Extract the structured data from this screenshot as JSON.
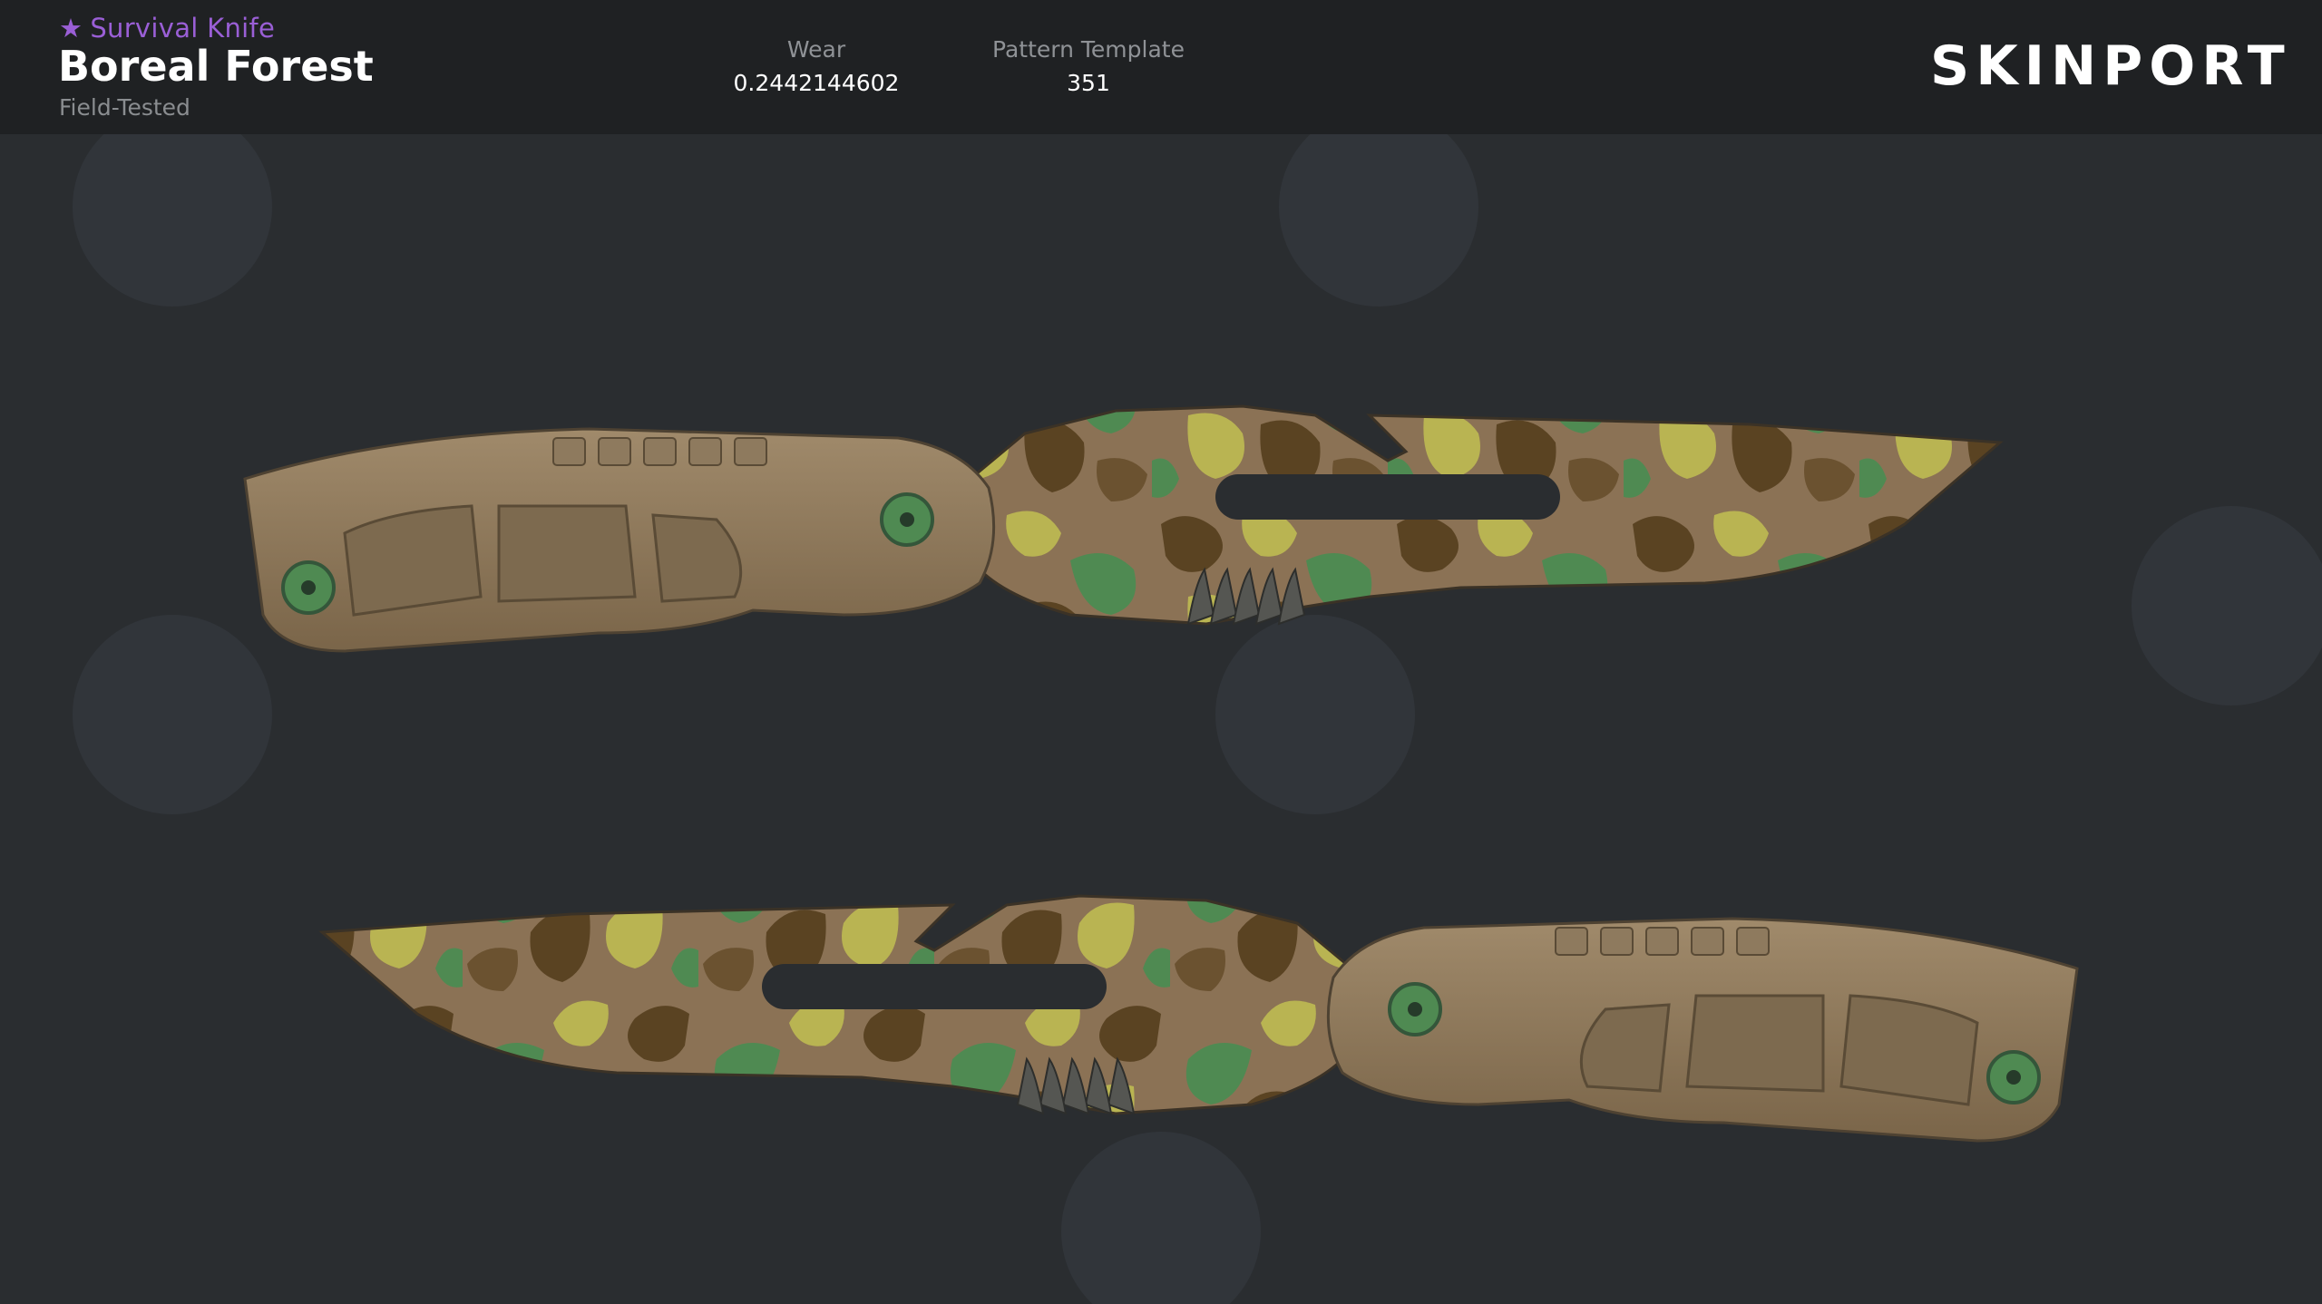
{
  "item": {
    "star": "★",
    "type": "Survival Knife",
    "name": "Boreal Forest",
    "exterior": "Field-Tested"
  },
  "stats": {
    "wear_label": "Wear",
    "wear_value": "0.2442144602",
    "pattern_label": "Pattern Template",
    "pattern_value": "351"
  },
  "brand": {
    "logo_text": "SKINPORT",
    "accent_color": "#fa490a"
  },
  "colors": {
    "background": "#2a2d30",
    "header": "#1f2123",
    "rarity": "#9a5fd6",
    "handle": "#8e7a5e",
    "camo_tan": "#8b7255",
    "camo_brown": "#5a4322",
    "camo_green": "#4f8a52",
    "camo_yellow": "#b9b452"
  },
  "images": [
    {
      "icon": "knife-image-right-facing"
    },
    {
      "icon": "knife-image-left-facing"
    }
  ]
}
